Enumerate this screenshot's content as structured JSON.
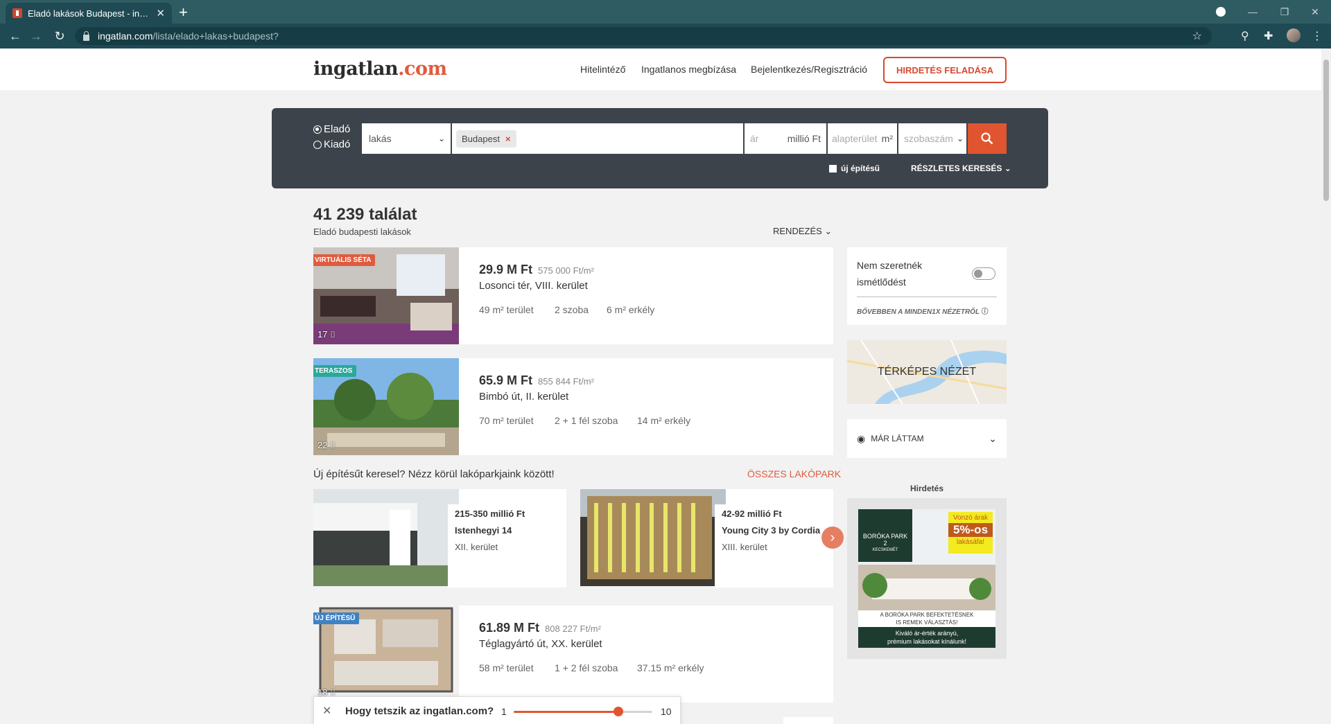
{
  "browser": {
    "tab_title": "Eladó lakások Budapest - ingatlan.com",
    "url_host": "ingatlan.com",
    "url_path": "/lista/elado+lakas+budapest?"
  },
  "header": {
    "logo_main": "ingatlan",
    "logo_tld": ".com",
    "nav": [
      "Hitelintéző",
      "Ingatlanos megbízása",
      "Bejelentkezés/Regisztráció"
    ],
    "cta": "HIRDETÉS FELADÁSA"
  },
  "search": {
    "radio_sale": "Eladó",
    "radio_rent": "Kiadó",
    "type_value": "lakás",
    "location_chip": "Budapest",
    "price_placeholder": "ár",
    "price_unit": "millió Ft",
    "area_placeholder": "alapterület",
    "area_unit": "m²",
    "rooms_placeholder": "szobaszám",
    "new_build_label": "új építésű",
    "advanced_label": "RÉSZLETES KERESÉS"
  },
  "results": {
    "count": "41 239 találat",
    "subtitle": "Eladó budapesti lakások",
    "sort_label": "RENDEZÉS"
  },
  "listings": [
    {
      "badge": "VIRTUÁLIS SÉTA",
      "badge_color": "#e05b3d",
      "photos": "17",
      "price": "29.9 M Ft",
      "sqm_price": "575 000 Ft/m²",
      "address": "Losonci tér, VIII. kerület",
      "area": "49 m² terület",
      "rooms": "2 szoba",
      "balcony": "6 m² erkély"
    },
    {
      "badge": "TERASZOS",
      "badge_color": "#2aa89a",
      "photos": "22",
      "price": "65.9 M Ft",
      "sqm_price": "855 844 Ft/m²",
      "address": "Bimbó út, II. kerület",
      "area": "70 m² terület",
      "rooms": "2 + 1 fél szoba",
      "balcony": "14 m² erkély"
    },
    {
      "badge": "ÚJ ÉPÍTÉSŰ",
      "badge_color": "#3f82c4",
      "photos": "18",
      "price": "61.89 M Ft",
      "sqm_price": "808 227 Ft/m²",
      "address": "Téglagyártó út, XX. kerület",
      "area": "58 m² terület",
      "rooms": "1 + 2 fél szoba",
      "balcony": "37.15 m² erkély"
    }
  ],
  "lakopark": {
    "title": "Új építésűt keresel? Nézz körül lakóparkjaink között!",
    "all_link": "ÖSSZES LAKÓPARK",
    "items": [
      {
        "price": "215-350 millió Ft",
        "name": "Istenhegyi 14",
        "district": "XII. kerület"
      },
      {
        "price": "42-92 millió Ft",
        "name": "Young City 3 by Cordia",
        "district": "XIII. kerület"
      }
    ]
  },
  "sidebar": {
    "toggle_label_1": "Nem szeretnék",
    "toggle_label_2": "ismétlődést",
    "more_link": "BŐVEBBEN A MINDEN1X NÉZETRŐL",
    "map_label": "TÉRKÉPES NÉZET",
    "seen_label": "MÁR LÁTTAM",
    "ad_label": "Hirdetés",
    "ad": {
      "brand_1": "BORÓKA PARK",
      "brand_2": "2",
      "city": "KECSKEMÉT",
      "promo_1": "Vonzó árak",
      "promo_2": "5%-os",
      "promo_3": "lakásáfa!",
      "line_1": "A BORÓKA PARK BEFEKTETÉSNEK",
      "line_2": "IS REMEK VÁLASZTÁS!",
      "line_3": "Kiváló ár-érték arányú,",
      "line_4": "prémium lakásokat kínálunk!"
    }
  },
  "rating": {
    "question": "Hogy tetszik az ingatlan.com?",
    "min": "1",
    "max": "10",
    "value": 7.8
  },
  "colors": {
    "accent": "#e0552f",
    "search_bg": "#3d434a",
    "chrome": "#2f5c63"
  }
}
